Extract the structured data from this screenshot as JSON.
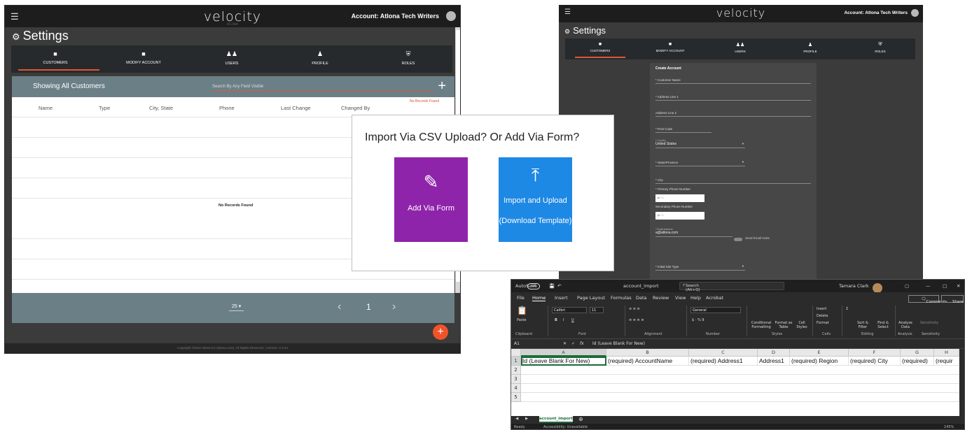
{
  "win_left": {
    "brand": "velocity",
    "brand_sub": "ATLONA",
    "account": "Account:  Atlona Tech Writers",
    "settings_title": "Settings",
    "tabs": [
      {
        "label": "CUSTOMERS",
        "icon": "user-card-icon"
      },
      {
        "label": "MODIFY ACCOUNT",
        "icon": "user-card-icon"
      },
      {
        "label": "USERS",
        "icon": "users-icon"
      },
      {
        "label": "PROFILE",
        "icon": "person-icon"
      },
      {
        "label": "ROLES",
        "icon": "shield-icon"
      }
    ],
    "showing": "Showing All Customers",
    "search_placeholder": "Search By Any Field Visible",
    "no_records_red": "No Records Found",
    "columns": [
      "Name",
      "Type",
      "City, State",
      "Phone",
      "Last Change",
      "Changed By"
    ],
    "no_records": "No Records Found",
    "per_page": "25",
    "page_num": "1",
    "footer": "Copyright ©2022 Atlona Inc (atlona.com). All Rights Reserved. | Version: 2.2.23"
  },
  "win_right": {
    "brand": "velocity",
    "account": "Account:  Atlona Tech Writers",
    "settings_title": "Settings",
    "tabs": [
      "CUSTOMERS",
      "MODIFY ACCOUNT",
      "USERS",
      "PROFILE",
      "ROLES"
    ],
    "form_title": "Create Account",
    "fields": {
      "customer_name": "* Customer Name",
      "address1": "* Address Line 1",
      "address2": "Address Line 2",
      "post_code": "* Post Code",
      "country_label": "* Country",
      "country_value": "United States",
      "state": "* State/Province",
      "city": "* City",
      "primary_phone": "* Primary Phone Number",
      "secondary_phone": "Secondary Phone Number",
      "phone_prefix": "+1",
      "email_label": "* Email Address",
      "email_value": "a@atlona.com",
      "send_invite": "Send Email Invite",
      "site_type": "* Initial Site Type"
    }
  },
  "modal": {
    "title": "Import Via CSV Upload? Or Add Via Form?",
    "add_form": "Add Via Form",
    "import_upload": "Import and Upload",
    "download_template": "(Download Template)"
  },
  "excel": {
    "autosave": "AutoSave",
    "autosave_state": "Off",
    "filename": "account_import",
    "search": "Search (Alt+Q)",
    "user": "Tamara Clark",
    "menu": [
      "File",
      "Home",
      "Insert",
      "Page Layout",
      "Formulas",
      "Data",
      "Review",
      "View",
      "Help",
      "Acrobat"
    ],
    "comments": "Comments",
    "share": "Share",
    "ribbon": {
      "paste": "Paste",
      "font": "Calibri",
      "size": "11",
      "number_format": "General",
      "conditional": "Conditional Formatting",
      "format_table": "Format as Table",
      "cell_styles": "Cell Styles",
      "insert": "Insert",
      "delete": "Delete",
      "format": "Format",
      "sort": "Sort & Filter",
      "find": "Find & Select",
      "analyze": "Analyze Data",
      "sensitivity": "Sensitivity",
      "groups": [
        "Clipboard",
        "Font",
        "Alignment",
        "Number",
        "Styles",
        "Cells",
        "Editing",
        "Analysis",
        "Sensitivity"
      ]
    },
    "namebox": "A1",
    "formula": "Id (Leave Blank For New)",
    "columns": [
      "A",
      "B",
      "C",
      "D",
      "E",
      "F",
      "G",
      "H"
    ],
    "rows": [
      "1",
      "2",
      "3",
      "4",
      "5"
    ],
    "row1": [
      "Id (Leave Blank For New)",
      "(required) AccountName",
      "(required) Address1",
      "Address1",
      "(required) Region",
      "(required) City",
      "(required)",
      "(requir"
    ],
    "sheet_tab": "account_import",
    "status_ready": "Ready",
    "accessibility": "Accessibility: Unavailable",
    "zoom": "145%"
  }
}
